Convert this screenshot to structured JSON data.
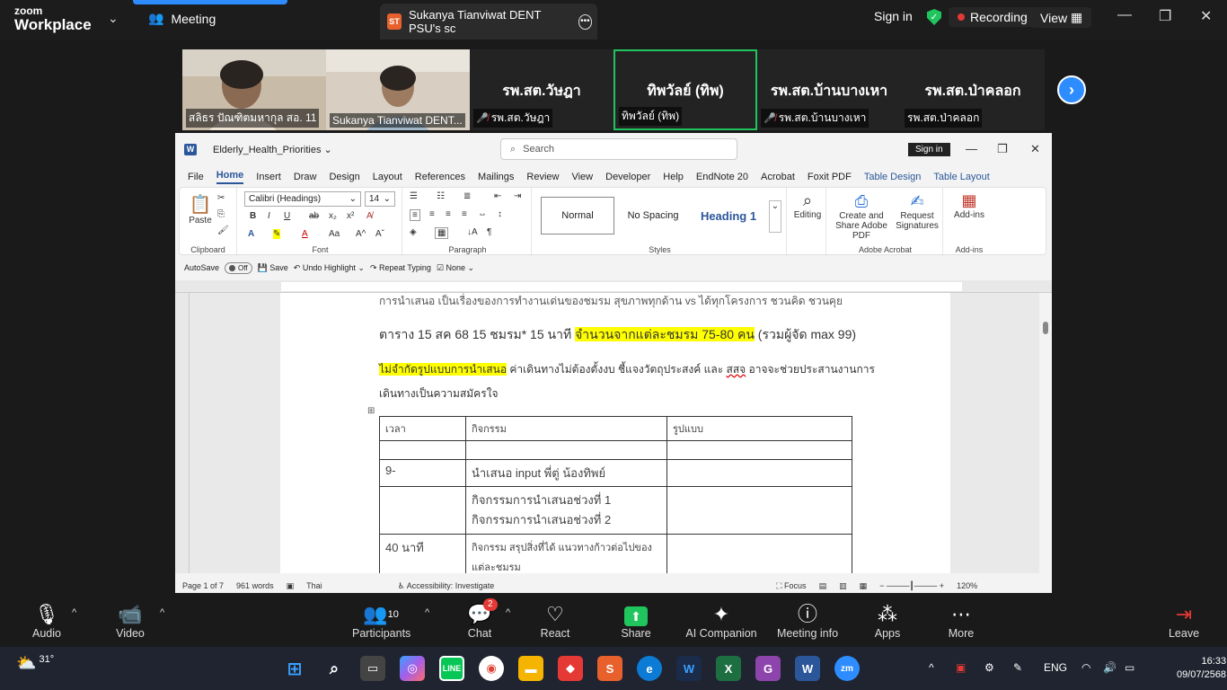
{
  "zoom": {
    "logo_line1": "zoom",
    "logo_line2": "Workplace",
    "meeting_tab": "Meeting",
    "share_badge": "ST",
    "share_tab": "Sukanya Tianviwat DENT PSU's sc",
    "sign_in": "Sign in",
    "recording": "Recording",
    "view": "View"
  },
  "participants": [
    {
      "name": "สลิธร ปัณฑิตมหากุล สอ. 11",
      "type": "video"
    },
    {
      "name": "Sukanya Tianviwat DENT...",
      "type": "video"
    },
    {
      "big": "รพ.สต.วัษฎา",
      "name": "รพ.สต.วัษฎา",
      "muted": true
    },
    {
      "big": "ทิพวัลย์ (ทิพ)",
      "name": "ทิพวัลย์ (ทิพ)",
      "muted": false,
      "active": true
    },
    {
      "big": "รพ.สต.บ้านบางเหา",
      "name": "รพ.สต.บ้านบางเหา",
      "muted": true
    },
    {
      "big": "รพ.สต.ป่าคลอก",
      "name": "รพ.สต.ป่าคลอก",
      "muted": false
    }
  ],
  "word": {
    "doc_name": "Elderly_Health_Priorities",
    "search_placeholder": "Search",
    "sign_in": "Sign in",
    "menu": [
      "File",
      "Home",
      "Insert",
      "Draw",
      "Design",
      "Layout",
      "References",
      "Mailings",
      "Review",
      "View",
      "Developer",
      "Help",
      "EndNote 20",
      "Acrobat",
      "Foxit PDF",
      "Table Design",
      "Table Layout"
    ],
    "ribbon": {
      "paste": "Paste",
      "clipboard": "Clipboard",
      "font_name": "Calibri (Headings)",
      "font_size": "14",
      "font": "Font",
      "paragraph": "Paragraph",
      "styles": "Styles",
      "style_normal": "Normal",
      "style_nospacing": "No Spacing",
      "style_heading1": "Heading 1",
      "editing": "Editing",
      "create_share": "Create and Share Adobe PDF",
      "request_sig": "Request Signatures",
      "adobe_acrobat": "Adobe Acrobat",
      "addins": "Add-ins",
      "addins_group": "Add-ins"
    },
    "quickbar": {
      "autosave": "AutoSave",
      "off": "Off",
      "save": "Save",
      "undo": "Undo Highlight",
      "repeat": "Repeat Typing",
      "none": "None"
    },
    "doc": {
      "line0": "การนำเสนอ เป็นเรื่องของการทำงานเด่นของชมรม สุขภาพทุกด้าน vs ได้ทุกโครงการ ชวนคิด ชวนคุย",
      "line1_a": "ตาราง 15 สค 68  15 ชมรม*  15 นาที ",
      "line1_hl": "จำนวนจากแต่ละชมรม 75-80 คน",
      "line1_b": " (รวมผู้จัด max  99)",
      "line2_hl": "ไม่จำกัดรูปแบบการนำเสนอ",
      "line2_b": " ค่าเดินทางไม่ต้องตั้งงบ ชี้แจงวัตถุประสงค์ และ ",
      "line2_u": "สสจ",
      "line2_c": " อาจจะช่วยประสานงานการ",
      "line3": "เดินทางเป็นความสมัครใจ",
      "table": [
        [
          "เวลา",
          "กิจกรรม",
          "รูปแบบ"
        ],
        [
          "",
          "",
          ""
        ],
        [
          "9-",
          "นำเสนอ input พี่ตู่ น้องทิพย์",
          ""
        ],
        [
          "",
          "กิจกรรมการนำเสนอช่วงที่ 1\nกิจกรรมการนำเสนอช่วงที่ 2",
          ""
        ],
        [
          "40 นาที",
          "กิจกรรม สรุปสิ่งที่ได้ แนวทางก้าวต่อไปของแต่ละชมรม",
          ""
        ]
      ]
    },
    "status": {
      "page": "Page 1 of 7",
      "words": "961 words",
      "lang": "Thai",
      "accessibility": "Accessibility: Investigate",
      "focus": "Focus",
      "zoom": "120%"
    }
  },
  "toolbar": {
    "audio": "Audio",
    "video": "Video",
    "participants": "Participants",
    "participants_count": "10",
    "chat": "Chat",
    "chat_badge": "2",
    "react": "React",
    "share": "Share",
    "ai": "AI Companion",
    "info": "Meeting info",
    "apps": "Apps",
    "more": "More",
    "leave": "Leave"
  },
  "taskbar": {
    "temp": "31°",
    "lang": "ENG",
    "time": "16:33",
    "date": "09/07/2568"
  }
}
